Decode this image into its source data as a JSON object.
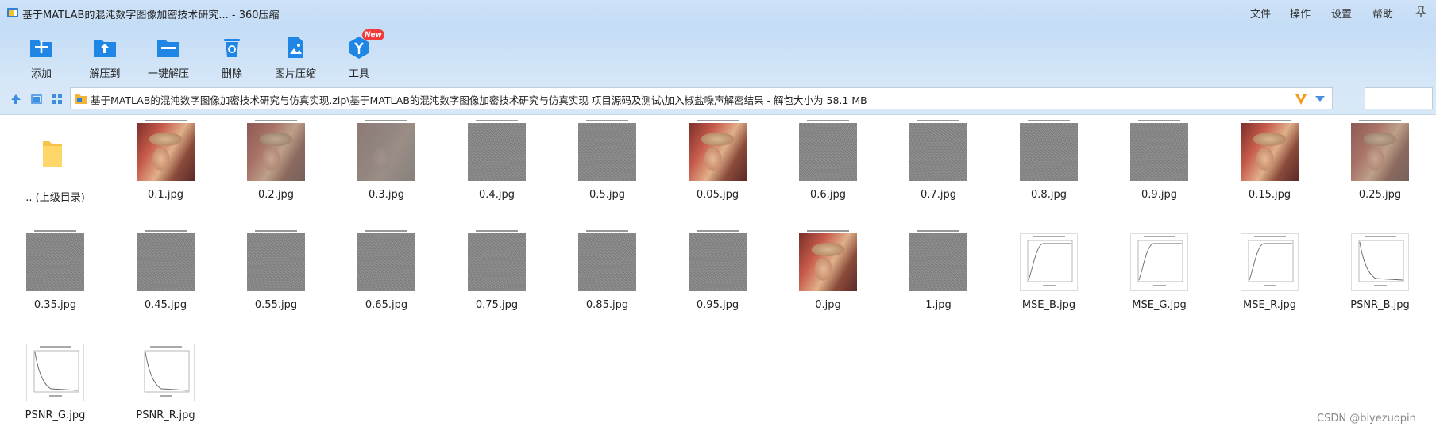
{
  "window": {
    "title": "基于MATLAB的混沌数字图像加密技术研究... - 360压缩",
    "menu": [
      "文件",
      "操作",
      "设置",
      "帮助"
    ]
  },
  "toolbar": {
    "tools": [
      {
        "label": "添加",
        "icon": "add-archive-icon"
      },
      {
        "label": "解压到",
        "icon": "extract-to-icon"
      },
      {
        "label": "一键解压",
        "icon": "one-click-extract-icon"
      },
      {
        "label": "删除",
        "icon": "delete-icon"
      },
      {
        "label": "图片压缩",
        "icon": "image-compress-icon"
      },
      {
        "label": "工具",
        "icon": "tools-icon",
        "badge": "New"
      }
    ]
  },
  "address": {
    "path": "基于MATLAB的混沌数字图像加密技术研究与仿真实现.zip\\基于MATLAB的混沌数字图像加密技术研究与仿真实现 项目源码及测试\\加入椒盐噪声解密结果 - 解包大小为 58.1 MB"
  },
  "files": [
    {
      "name": ".. (上级目录)",
      "kind": "folder"
    },
    {
      "name": "0.1.jpg",
      "kind": "lena"
    },
    {
      "name": "0.2.jpg",
      "kind": "lena-faded"
    },
    {
      "name": "0.3.jpg",
      "kind": "lena-noisy"
    },
    {
      "name": "0.4.jpg",
      "kind": "noise"
    },
    {
      "name": "0.5.jpg",
      "kind": "noise"
    },
    {
      "name": "0.05.jpg",
      "kind": "lena"
    },
    {
      "name": "0.6.jpg",
      "kind": "noise"
    },
    {
      "name": "0.7.jpg",
      "kind": "noise"
    },
    {
      "name": "0.8.jpg",
      "kind": "noise"
    },
    {
      "name": "0.9.jpg",
      "kind": "noise"
    },
    {
      "name": "0.15.jpg",
      "kind": "lena"
    },
    {
      "name": "0.25.jpg",
      "kind": "lena-faded"
    },
    {
      "name": "0.35.jpg",
      "kind": "noise"
    },
    {
      "name": "0.45.jpg",
      "kind": "noise"
    },
    {
      "name": "0.55.jpg",
      "kind": "noise"
    },
    {
      "name": "0.65.jpg",
      "kind": "noise"
    },
    {
      "name": "0.75.jpg",
      "kind": "noise"
    },
    {
      "name": "0.85.jpg",
      "kind": "noise"
    },
    {
      "name": "0.95.jpg",
      "kind": "noise"
    },
    {
      "name": "0.jpg",
      "kind": "lena"
    },
    {
      "name": "1.jpg",
      "kind": "noise"
    },
    {
      "name": "MSE_B.jpg",
      "kind": "plot-rise"
    },
    {
      "name": "MSE_G.jpg",
      "kind": "plot-rise"
    },
    {
      "name": "MSE_R.jpg",
      "kind": "plot-rise"
    },
    {
      "name": "PSNR_B.jpg",
      "kind": "plot-fall"
    },
    {
      "name": "PSNR_G.jpg",
      "kind": "plot-fall"
    },
    {
      "name": "PSNR_R.jpg",
      "kind": "plot-fall"
    }
  ],
  "watermark": "CSDN @biyezuopin"
}
